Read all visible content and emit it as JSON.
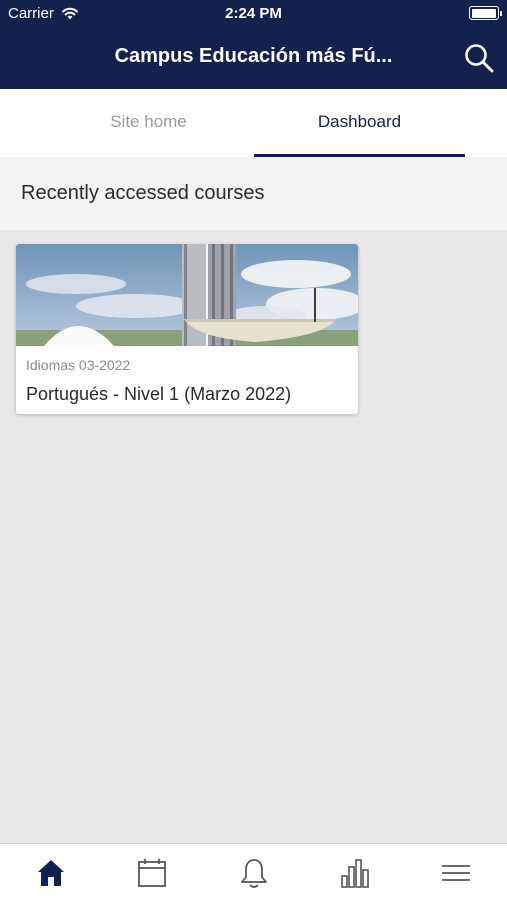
{
  "status_bar": {
    "carrier": "Carrier",
    "time": "2:24 PM",
    "battery_level": 1.0
  },
  "header": {
    "title": "Campus Educación más Fú...",
    "search_icon": "search-icon"
  },
  "tabs": [
    {
      "label": "Site home",
      "active": false
    },
    {
      "label": "Dashboard",
      "active": true
    }
  ],
  "section": {
    "title": "Recently accessed courses"
  },
  "courses": [
    {
      "category": "Idiomas 03-2022",
      "name": "Portugués - Nivel 1 (Marzo 2022)",
      "image": "brasilia-congress-photo"
    }
  ],
  "bottom_nav": [
    {
      "icon": "home-icon",
      "active": true
    },
    {
      "icon": "calendar-icon",
      "active": false
    },
    {
      "icon": "bell-icon",
      "active": false
    },
    {
      "icon": "bar-chart-icon",
      "active": false
    },
    {
      "icon": "menu-icon",
      "active": false
    }
  ],
  "colors": {
    "brand": "#13214f",
    "inactive_tab": "#9a9a9a",
    "background": "#e8e8e8",
    "icon_inactive": "#555555"
  }
}
